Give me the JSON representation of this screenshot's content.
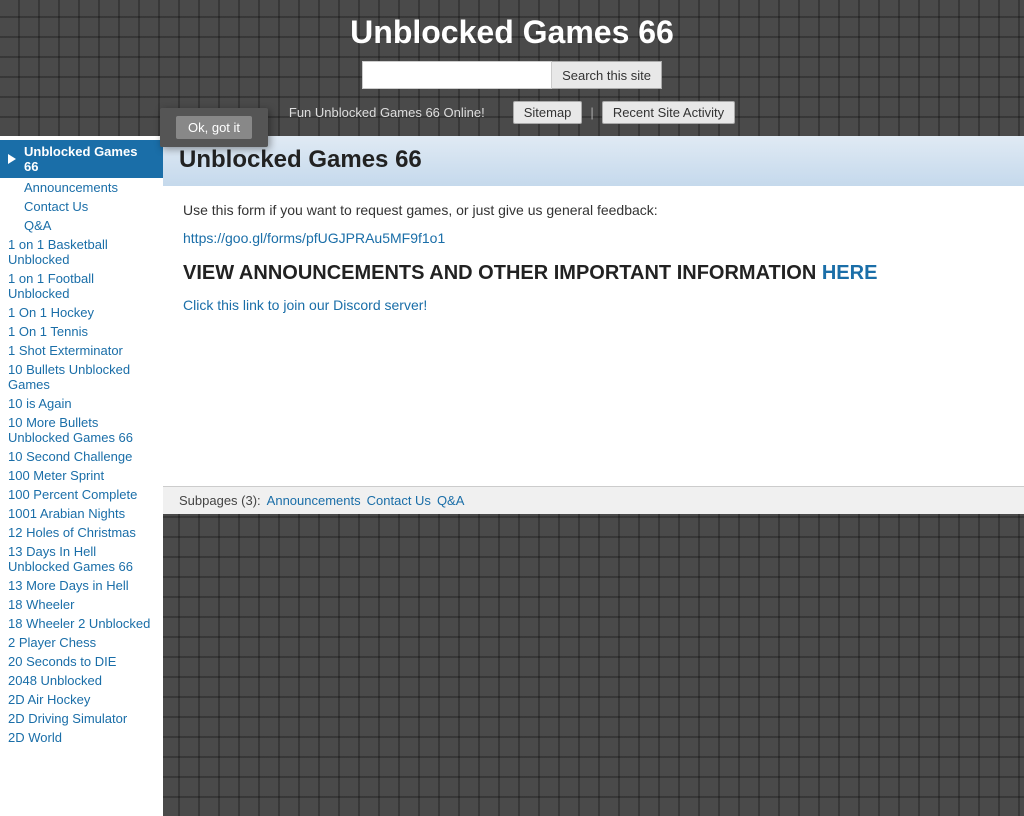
{
  "header": {
    "site_title": "Unblocked Games 66",
    "search_placeholder": "",
    "search_button_label": "Search this site",
    "tagline": "Fun Unblocked Games 66 Online!",
    "nav_links": [
      {
        "label": "Sitemap"
      },
      {
        "label": "Recent Site Activity"
      }
    ]
  },
  "cookie_banner": {
    "text": "Ok, got it"
  },
  "sidebar": {
    "header_label": "Unblocked Games 66",
    "sub_items": [
      {
        "label": "Announcements"
      },
      {
        "label": "Contact Us"
      },
      {
        "label": "Q&A"
      }
    ],
    "items": [
      {
        "label": "1 on 1 Basketball Unblocked"
      },
      {
        "label": "1 on 1 Football Unblocked"
      },
      {
        "label": "1 On 1 Hockey"
      },
      {
        "label": "1 On 1 Tennis"
      },
      {
        "label": "1 Shot Exterminator"
      },
      {
        "label": "10 Bullets Unblocked Games"
      },
      {
        "label": "10 is Again"
      },
      {
        "label": "10 More Bullets Unblocked Games 66"
      },
      {
        "label": "10 Second Challenge"
      },
      {
        "label": "100 Meter Sprint"
      },
      {
        "label": "100 Percent Complete"
      },
      {
        "label": "1001 Arabian Nights"
      },
      {
        "label": "12 Holes of Christmas"
      },
      {
        "label": "13 Days In Hell Unblocked Games 66"
      },
      {
        "label": "13 More Days in Hell"
      },
      {
        "label": "18 Wheeler"
      },
      {
        "label": "18 Wheeler 2 Unblocked"
      },
      {
        "label": "2 Player Chess"
      },
      {
        "label": "20 Seconds to DIE"
      },
      {
        "label": "2048 Unblocked"
      },
      {
        "label": "2D Air Hockey"
      },
      {
        "label": "2D Driving Simulator"
      },
      {
        "label": "2D World"
      }
    ]
  },
  "main": {
    "page_title": "Unblocked Games 66",
    "form_intro": "Use this form if you want to request games, or just give us general feedback:",
    "form_link_text": "https://goo.gl/forms/pfUGJPRAu5MF9f1o1",
    "announcements_heading": "VIEW ANNOUNCEMENTS AND OTHER IMPORTANT INFORMATION ",
    "here_label": "HERE",
    "discord_link_text": "Click this link to join our Discord server!",
    "subpages_label": "Subpages (3):",
    "subpages": [
      {
        "label": "Announcements"
      },
      {
        "label": "Contact Us"
      },
      {
        "label": "Q&A"
      }
    ]
  }
}
